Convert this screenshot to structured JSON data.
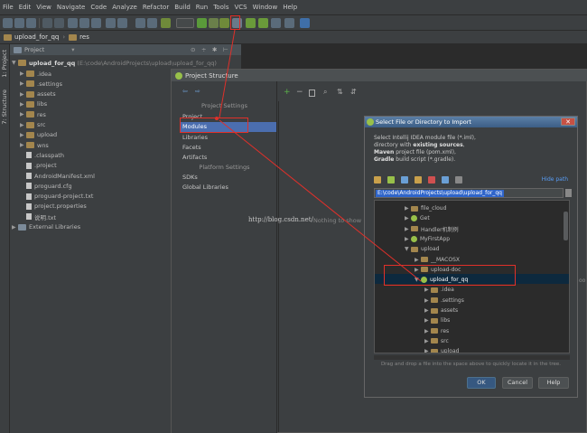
{
  "menu": [
    "File",
    "Edit",
    "View",
    "Navigate",
    "Code",
    "Analyze",
    "Refactor",
    "Build",
    "Run",
    "Tools",
    "VCS",
    "Window",
    "Help"
  ],
  "nav": {
    "project": "upload_for_qq",
    "folder": "res"
  },
  "side_tabs": {
    "project": "1: Project",
    "structure": "7: Structure"
  },
  "project_panel": {
    "header": "Project",
    "root": {
      "name": "upload_for_qq",
      "path": "(E:\\code\\AndroidProjects\\upload\\upload_for_qq)"
    },
    "items": [
      {
        "name": ".idea",
        "type": "folder"
      },
      {
        "name": ".settings",
        "type": "folder"
      },
      {
        "name": "assets",
        "type": "folder"
      },
      {
        "name": "libs",
        "type": "folder"
      },
      {
        "name": "res",
        "type": "folder"
      },
      {
        "name": "src",
        "type": "folder"
      },
      {
        "name": "upload",
        "type": "folder"
      },
      {
        "name": "wns",
        "type": "folder"
      },
      {
        "name": ".classpath",
        "type": "file"
      },
      {
        "name": ".project",
        "type": "file"
      },
      {
        "name": "AndroidManifest.xml",
        "type": "file"
      },
      {
        "name": "proguard.cfg",
        "type": "file"
      },
      {
        "name": "proguard-project.txt",
        "type": "file"
      },
      {
        "name": "project.properties",
        "type": "file"
      },
      {
        "name": "说明.txt",
        "type": "file"
      }
    ],
    "external": "External Libraries"
  },
  "project_structure": {
    "title": "Project Structure",
    "section1": "Project Settings",
    "items1": [
      "Project",
      "Modules",
      "Libraries",
      "Facets",
      "Artifacts"
    ],
    "section2": "Platform Settings",
    "items2": [
      "SDKs",
      "Global Libraries"
    ],
    "nothing": "Nothing to show"
  },
  "import_dialog": {
    "title": "Select File or Directory to Import",
    "desc1": "Select Intellij IDEA module file (*.iml),",
    "desc2_pre": "directory with ",
    "desc2_b": "existing sources",
    "desc3_b": "Maven",
    "desc3_post": " project file (pom.xml),",
    "desc4_b": "Gradle",
    "desc4_post": " build script (*.gradle).",
    "hide_path": "Hide path",
    "path": "E:\\code\\AndroidProjects\\upload\\upload_for_qq",
    "tree": [
      {
        "name": "file_cloud",
        "level": 0,
        "exp": false,
        "kind": "folder"
      },
      {
        "name": "Get",
        "level": 0,
        "exp": false,
        "kind": "android"
      },
      {
        "name": "Handler机制例",
        "level": 0,
        "exp": false,
        "kind": "folder"
      },
      {
        "name": "MyFirstApp",
        "level": 0,
        "exp": false,
        "kind": "android"
      },
      {
        "name": "upload",
        "level": 0,
        "exp": true,
        "kind": "folder"
      },
      {
        "name": "__MACOSX",
        "level": 1,
        "exp": false,
        "kind": "folder"
      },
      {
        "name": "upload-doc",
        "level": 1,
        "exp": false,
        "kind": "folder"
      },
      {
        "name": "upload_for_qq",
        "level": 1,
        "exp": true,
        "kind": "android",
        "selected": true
      },
      {
        "name": ".idea",
        "level": 2,
        "exp": false,
        "kind": "folder"
      },
      {
        "name": ".settings",
        "level": 2,
        "exp": false,
        "kind": "folder"
      },
      {
        "name": "assets",
        "level": 2,
        "exp": false,
        "kind": "folder"
      },
      {
        "name": "libs",
        "level": 2,
        "exp": false,
        "kind": "folder"
      },
      {
        "name": "res",
        "level": 2,
        "exp": false,
        "kind": "folder"
      },
      {
        "name": "src",
        "level": 2,
        "exp": false,
        "kind": "folder"
      },
      {
        "name": "upload",
        "level": 2,
        "exp": false,
        "kind": "folder"
      }
    ],
    "hint": "Drag and drop a file into the space above to quickly locate it in the tree.",
    "ok": "OK",
    "cancel": "Cancel",
    "help": "Help"
  },
  "watermark": "http://blog.csdn.net/",
  "edge_text": "oo",
  "colors": {
    "folder": "#a3864d",
    "android": "#98c04a",
    "selection": "#2f65ca",
    "annotation": "#e0302a"
  }
}
